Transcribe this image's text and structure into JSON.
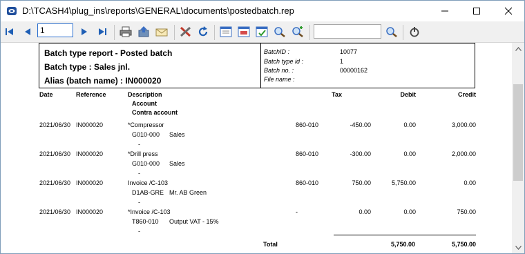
{
  "window": {
    "title": "D:\\TCASH4\\plug_ins\\reports\\GENERAL\\documents\\postedbatch.rep"
  },
  "toolbar": {
    "page_value": "1",
    "search_value": ""
  },
  "report": {
    "header": {
      "title": "Batch type report - Posted batch",
      "batch_type": "Batch type  :  Sales jnl.",
      "alias": "Alias (batch name)  :  IN000020",
      "batchid_label": "BatchID  :",
      "batchid_value": "10077",
      "batchtype_label": "Batch type id  :",
      "batchtype_value": "1",
      "batchno_label": "Batch no.  :",
      "batchno_value": "00000162",
      "filename_label": "File name  :"
    },
    "columns": {
      "date": "Date",
      "reference": "Reference",
      "description": "Description",
      "account": "Account",
      "contra": "Contra account",
      "tax": "Tax",
      "debit": "Debit",
      "credit": "Credit"
    },
    "rows": [
      {
        "date": "2021/06/30",
        "ref": "IN000020",
        "desc": "*Compressor",
        "taxcode": "860-010",
        "tax": "-450.00",
        "debit": "0.00",
        "credit": "3,000.00",
        "account": "G010-000",
        "account_name": "Sales",
        "contra": "-"
      },
      {
        "date": "2021/06/30",
        "ref": "IN000020",
        "desc": "*Drill press",
        "taxcode": "860-010",
        "tax": "-300.00",
        "debit": "0.00",
        "credit": "2,000.00",
        "account": "G010-000",
        "account_name": "Sales",
        "contra": "-"
      },
      {
        "date": "2021/06/30",
        "ref": "IN000020",
        "desc": "Invoice /C-103",
        "taxcode": "860-010",
        "tax": "750.00",
        "debit": "5,750.00",
        "credit": "0.00",
        "account": "D1AB-GRE",
        "account_name": "Mr. AB Green",
        "contra": "-"
      },
      {
        "date": "2021/06/30",
        "ref": "IN000020",
        "desc": "*Invoice /C-103",
        "taxcode": "-",
        "tax": "0.00",
        "debit": "0.00",
        "credit": "750.00",
        "account": "T860-010",
        "account_name": "Output VAT - 15%",
        "contra": "-"
      }
    ],
    "total": {
      "label": "Total",
      "debit": "5,750.00",
      "credit": "5,750.00"
    }
  }
}
